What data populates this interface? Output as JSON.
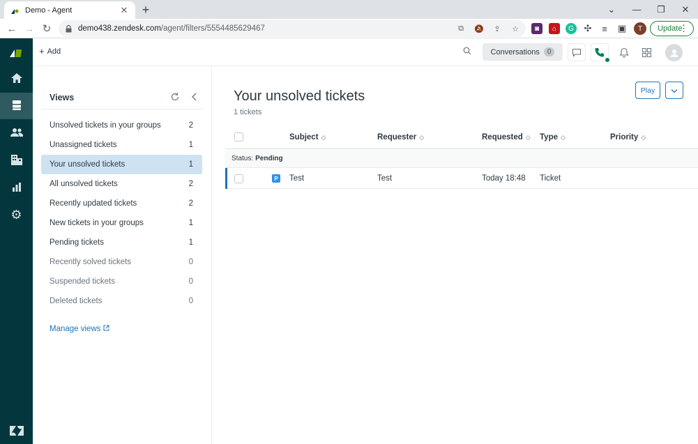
{
  "browser": {
    "tab_title": "Demo - Agent",
    "url_host": "demo438.zendesk.com",
    "url_path": "/agent/filters/5554485629467",
    "profile_initial": "T",
    "update_label": "Update"
  },
  "app": {
    "add_label": "Add",
    "conversations_label": "Conversations",
    "conversations_count": "0"
  },
  "views_panel": {
    "title": "Views",
    "items": [
      {
        "label": "Unsolved tickets in your groups",
        "count": "2"
      },
      {
        "label": "Unassigned tickets",
        "count": "1"
      },
      {
        "label": "Your unsolved tickets",
        "count": "1"
      },
      {
        "label": "All unsolved tickets",
        "count": "2"
      },
      {
        "label": "Recently updated tickets",
        "count": "2"
      },
      {
        "label": "New tickets in your groups",
        "count": "1"
      },
      {
        "label": "Pending tickets",
        "count": "1"
      },
      {
        "label": "Recently solved tickets",
        "count": "0"
      },
      {
        "label": "Suspended tickets",
        "count": "0"
      },
      {
        "label": "Deleted tickets",
        "count": "0"
      }
    ],
    "manage_label": "Manage views"
  },
  "main": {
    "title": "Your unsolved tickets",
    "ticket_count": "1 tickets",
    "play_label": "Play",
    "columns": {
      "subject": "Subject",
      "requester": "Requester",
      "requested": "Requested",
      "type": "Type",
      "priority": "Priority"
    },
    "group": {
      "prefix": "Status:",
      "value": "Pending"
    },
    "rows": [
      {
        "status_letter": "P",
        "subject": "Test",
        "requester": "Test",
        "requested": "Today 18:48",
        "type": "Ticket",
        "priority": ""
      }
    ]
  },
  "colors": {
    "nav_bg": "#03363d",
    "accent": "#1f73b7",
    "selected_view": "#cee2f2",
    "pending_badge": "#3091ec",
    "call_green": "#038153"
  }
}
